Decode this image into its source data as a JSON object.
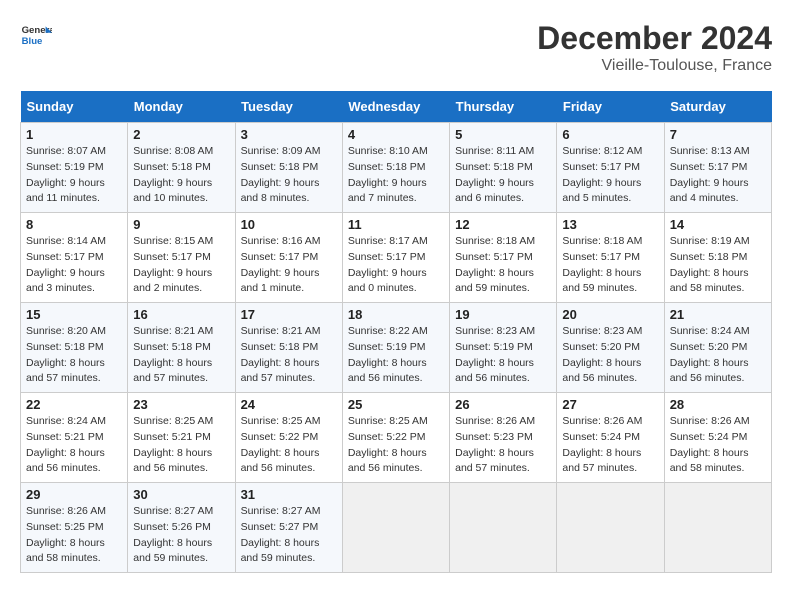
{
  "header": {
    "logo_line1": "General",
    "logo_line2": "Blue",
    "month": "December 2024",
    "location": "Vieille-Toulouse, France"
  },
  "weekdays": [
    "Sunday",
    "Monday",
    "Tuesday",
    "Wednesday",
    "Thursday",
    "Friday",
    "Saturday"
  ],
  "weeks": [
    [
      {
        "day": 1,
        "sunrise": "8:07 AM",
        "sunset": "5:19 PM",
        "daylight": "9 hours and 11 minutes."
      },
      {
        "day": 2,
        "sunrise": "8:08 AM",
        "sunset": "5:18 PM",
        "daylight": "9 hours and 10 minutes."
      },
      {
        "day": 3,
        "sunrise": "8:09 AM",
        "sunset": "5:18 PM",
        "daylight": "9 hours and 8 minutes."
      },
      {
        "day": 4,
        "sunrise": "8:10 AM",
        "sunset": "5:18 PM",
        "daylight": "9 hours and 7 minutes."
      },
      {
        "day": 5,
        "sunrise": "8:11 AM",
        "sunset": "5:18 PM",
        "daylight": "9 hours and 6 minutes."
      },
      {
        "day": 6,
        "sunrise": "8:12 AM",
        "sunset": "5:17 PM",
        "daylight": "9 hours and 5 minutes."
      },
      {
        "day": 7,
        "sunrise": "8:13 AM",
        "sunset": "5:17 PM",
        "daylight": "9 hours and 4 minutes."
      }
    ],
    [
      {
        "day": 8,
        "sunrise": "8:14 AM",
        "sunset": "5:17 PM",
        "daylight": "9 hours and 3 minutes."
      },
      {
        "day": 9,
        "sunrise": "8:15 AM",
        "sunset": "5:17 PM",
        "daylight": "9 hours and 2 minutes."
      },
      {
        "day": 10,
        "sunrise": "8:16 AM",
        "sunset": "5:17 PM",
        "daylight": "9 hours and 1 minute."
      },
      {
        "day": 11,
        "sunrise": "8:17 AM",
        "sunset": "5:17 PM",
        "daylight": "9 hours and 0 minutes."
      },
      {
        "day": 12,
        "sunrise": "8:18 AM",
        "sunset": "5:17 PM",
        "daylight": "8 hours and 59 minutes."
      },
      {
        "day": 13,
        "sunrise": "8:18 AM",
        "sunset": "5:17 PM",
        "daylight": "8 hours and 59 minutes."
      },
      {
        "day": 14,
        "sunrise": "8:19 AM",
        "sunset": "5:18 PM",
        "daylight": "8 hours and 58 minutes."
      }
    ],
    [
      {
        "day": 15,
        "sunrise": "8:20 AM",
        "sunset": "5:18 PM",
        "daylight": "8 hours and 57 minutes."
      },
      {
        "day": 16,
        "sunrise": "8:21 AM",
        "sunset": "5:18 PM",
        "daylight": "8 hours and 57 minutes."
      },
      {
        "day": 17,
        "sunrise": "8:21 AM",
        "sunset": "5:18 PM",
        "daylight": "8 hours and 57 minutes."
      },
      {
        "day": 18,
        "sunrise": "8:22 AM",
        "sunset": "5:19 PM",
        "daylight": "8 hours and 56 minutes."
      },
      {
        "day": 19,
        "sunrise": "8:23 AM",
        "sunset": "5:19 PM",
        "daylight": "8 hours and 56 minutes."
      },
      {
        "day": 20,
        "sunrise": "8:23 AM",
        "sunset": "5:20 PM",
        "daylight": "8 hours and 56 minutes."
      },
      {
        "day": 21,
        "sunrise": "8:24 AM",
        "sunset": "5:20 PM",
        "daylight": "8 hours and 56 minutes."
      }
    ],
    [
      {
        "day": 22,
        "sunrise": "8:24 AM",
        "sunset": "5:21 PM",
        "daylight": "8 hours and 56 minutes."
      },
      {
        "day": 23,
        "sunrise": "8:25 AM",
        "sunset": "5:21 PM",
        "daylight": "8 hours and 56 minutes."
      },
      {
        "day": 24,
        "sunrise": "8:25 AM",
        "sunset": "5:22 PM",
        "daylight": "8 hours and 56 minutes."
      },
      {
        "day": 25,
        "sunrise": "8:25 AM",
        "sunset": "5:22 PM",
        "daylight": "8 hours and 56 minutes."
      },
      {
        "day": 26,
        "sunrise": "8:26 AM",
        "sunset": "5:23 PM",
        "daylight": "8 hours and 57 minutes."
      },
      {
        "day": 27,
        "sunrise": "8:26 AM",
        "sunset": "5:24 PM",
        "daylight": "8 hours and 57 minutes."
      },
      {
        "day": 28,
        "sunrise": "8:26 AM",
        "sunset": "5:24 PM",
        "daylight": "8 hours and 58 minutes."
      }
    ],
    [
      {
        "day": 29,
        "sunrise": "8:26 AM",
        "sunset": "5:25 PM",
        "daylight": "8 hours and 58 minutes."
      },
      {
        "day": 30,
        "sunrise": "8:27 AM",
        "sunset": "5:26 PM",
        "daylight": "8 hours and 59 minutes."
      },
      {
        "day": 31,
        "sunrise": "8:27 AM",
        "sunset": "5:27 PM",
        "daylight": "8 hours and 59 minutes."
      },
      null,
      null,
      null,
      null
    ]
  ]
}
